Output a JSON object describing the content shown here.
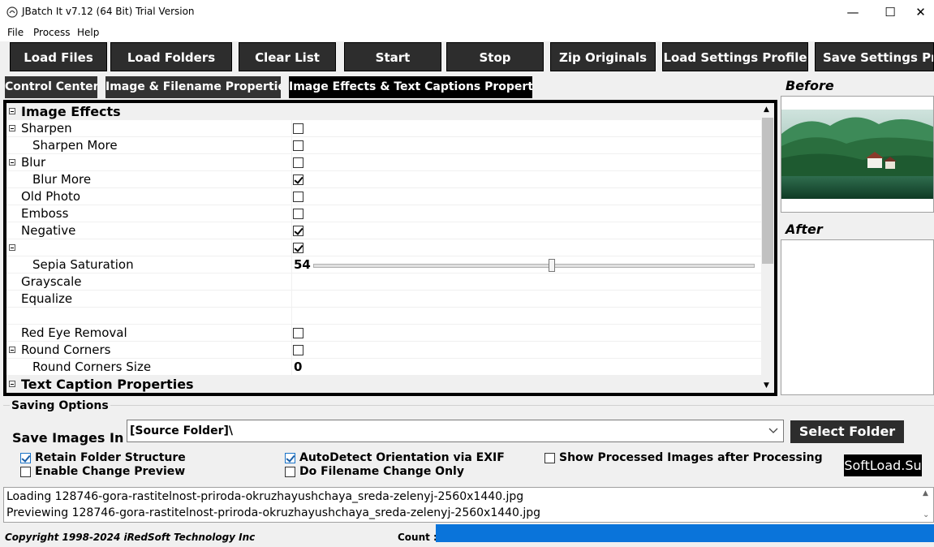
{
  "window": {
    "title": "JBatch It v7.12 (64 Bit) Trial Version",
    "minimize": "—",
    "maximize": "☐",
    "close": "✕"
  },
  "menu": [
    "File",
    "Process",
    "Help"
  ],
  "toolbar": {
    "load_files": "Load Files",
    "load_folders": "Load Folders",
    "clear_list": "Clear List",
    "start": "Start",
    "stop": "Stop",
    "zip_originals": "Zip Originals",
    "load_settings_profile": "Load Settings Profile",
    "save_settings_profile": "Save Settings Prof"
  },
  "tabs": [
    {
      "label": "Control Center",
      "active": false
    },
    {
      "label": "Image & Filename Properties",
      "active": false
    },
    {
      "label": "Image Effects & Text Captions Properties",
      "active": true
    }
  ],
  "grid": {
    "rows": [
      {
        "label": "Image Effects",
        "category": true,
        "expander": true
      },
      {
        "label": "Sharpen",
        "expander": true,
        "checkbox": false
      },
      {
        "label": "Sharpen More",
        "indent": true,
        "checkbox": false
      },
      {
        "label": "Blur",
        "expander": true,
        "checkbox": false
      },
      {
        "label": "Blur More",
        "indent": true,
        "checkbox": true
      },
      {
        "label": "Old Photo",
        "checkbox": false
      },
      {
        "label": "Emboss",
        "checkbox": false
      },
      {
        "label": "Negative",
        "checkbox": true
      },
      {
        "label": "",
        "expander": true,
        "checkbox": true
      },
      {
        "label": "Sepia Saturation",
        "indent": true,
        "value": "54",
        "slider": 0.54
      },
      {
        "label": "Grayscale"
      },
      {
        "label": "Equalize"
      },
      {
        "label": ""
      },
      {
        "label": "Red Eye Removal",
        "checkbox": false
      },
      {
        "label": "Round Corners",
        "expander": true,
        "checkbox": false
      },
      {
        "label": "Round Corners Size",
        "indent": true,
        "value": "0"
      },
      {
        "label": "Text Caption Properties",
        "category": true,
        "expander": true
      }
    ]
  },
  "preview": {
    "before_title": "Before",
    "after_title": "After"
  },
  "saving": {
    "group_title": "Saving Options",
    "save_in_label": "Save Images In",
    "folder_value": "[Source Folder]\\",
    "select_folder": "Select Folder",
    "options": {
      "retain_structure": {
        "label": "Retain Folder Structure",
        "checked": true
      },
      "enable_preview": {
        "label": "Enable Change Preview",
        "checked": false
      },
      "autodetect": {
        "label": "AutoDetect Orientation via EXIF",
        "checked": true
      },
      "filename_only": {
        "label": "Do Filename Change Only",
        "checked": false
      },
      "show_processed": {
        "label": "Show Processed Images after Processing",
        "checked": false
      }
    },
    "watermark": "SoftLoad.Su"
  },
  "log": [
    "Loading 128746-gora-rastitelnost-priroda-okruzhayushchaya_sreda-zelenyj-2560x1440.jpg",
    "Previewing 128746-gora-rastitelnost-priroda-okruzhayushchaya_sreda-zelenyj-2560x1440.jpg"
  ],
  "status": {
    "copyright": "Copyright 1998-2024 iRedSoft Technology Inc",
    "count_label": "Count :"
  },
  "colors": {
    "button_bg": "#2d2d2d",
    "progress": "#0a74da",
    "accent_check": "#1a73c8"
  }
}
